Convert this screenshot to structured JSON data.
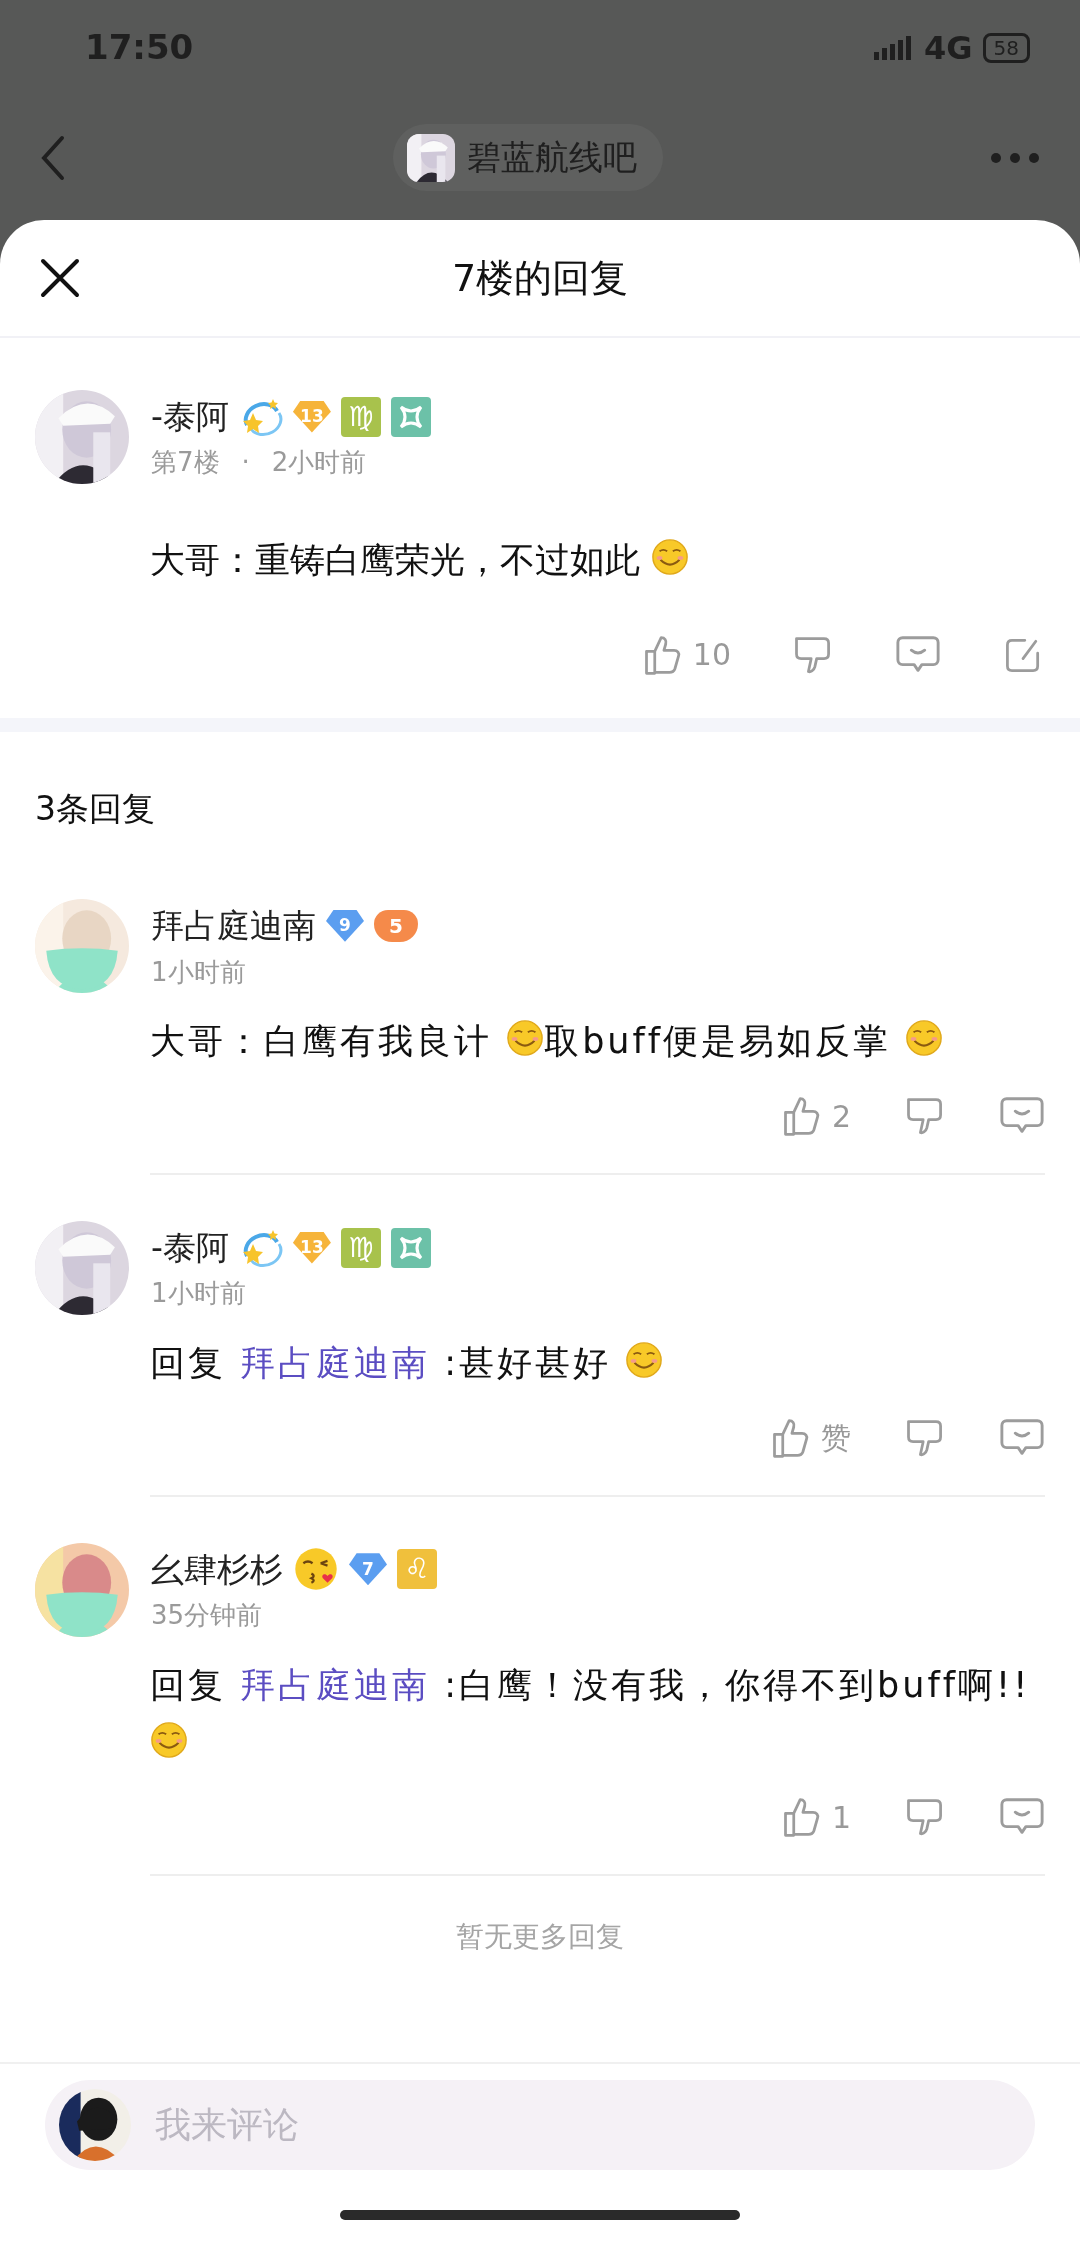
{
  "status_bar": {
    "time": "17:50",
    "network": "4G",
    "battery": "58"
  },
  "nav": {
    "forum": "碧蓝航线吧"
  },
  "sheet": {
    "title": "7楼的回复"
  },
  "post": {
    "author": "-泰阿",
    "badges": [
      {
        "kind": "star"
      },
      {
        "kind": "level",
        "text": "13",
        "color": "#f6b43a"
      },
      {
        "kind": "zodiac",
        "text": "♍",
        "color": "#a8c24c"
      },
      {
        "kind": "symbol",
        "color": "#6cc1a8"
      }
    ],
    "floor": "第7楼",
    "separator": "·",
    "time": "2小时前",
    "content": [
      {
        "kind": "text",
        "text": "大哥：重铸白鹰荣光，不过如此"
      },
      {
        "kind": "emoji"
      }
    ],
    "actions": [
      {
        "kind": "like",
        "count": "10"
      },
      {
        "kind": "dislike"
      },
      {
        "kind": "reply"
      },
      {
        "kind": "share"
      }
    ]
  },
  "reply_count": "3条回复",
  "replies": [
    {
      "author": "拜占庭迪南",
      "badges": [
        {
          "kind": "level",
          "text": "9",
          "color": "#5b9ef0"
        },
        {
          "kind": "game",
          "text": "5",
          "color": "#f58a4a"
        }
      ],
      "time": "1小时前",
      "content": [
        {
          "kind": "text",
          "text": "大哥：白鹰有我良计"
        },
        {
          "kind": "emoji"
        },
        {
          "kind": "text",
          "text": "取buff便是易如反掌"
        },
        {
          "kind": "emoji"
        }
      ],
      "actions": [
        {
          "kind": "like",
          "count": "2"
        },
        {
          "kind": "dislike"
        },
        {
          "kind": "reply"
        }
      ]
    },
    {
      "author": "-泰阿",
      "badges": [
        {
          "kind": "star"
        },
        {
          "kind": "level",
          "text": "13",
          "color": "#f6b43a"
        },
        {
          "kind": "zodiac",
          "text": "♍",
          "color": "#a8c24c"
        },
        {
          "kind": "symbol",
          "color": "#6cc1a8"
        }
      ],
      "time": "1小时前",
      "content": [
        {
          "kind": "text",
          "text": "回复"
        },
        {
          "kind": "mention",
          "text": "拜占庭迪南"
        },
        {
          "kind": "text",
          "text": ":甚好甚好"
        },
        {
          "kind": "emoji"
        }
      ],
      "actions": [
        {
          "kind": "like",
          "count": "赞"
        },
        {
          "kind": "dislike"
        },
        {
          "kind": "reply"
        }
      ]
    },
    {
      "author": "幺肆杉杉",
      "badges": [
        {
          "kind": "kiss"
        },
        {
          "kind": "level",
          "text": "7",
          "color": "#5b9ef0"
        },
        {
          "kind": "zodiac",
          "text": "♌",
          "color": "#f0c03c"
        }
      ],
      "time": "35分钟前",
      "content": [
        {
          "kind": "text",
          "text": "回复"
        },
        {
          "kind": "mention",
          "text": "拜占庭迪南"
        },
        {
          "kind": "text",
          "text": ":白鹰！没有我，你得不到buff啊!!"
        },
        {
          "kind": "emoji"
        }
      ],
      "actions": [
        {
          "kind": "like",
          "count": "1"
        },
        {
          "kind": "dislike"
        },
        {
          "kind": "reply"
        }
      ]
    }
  ],
  "footer": "暂无更多回复",
  "comment_box": {
    "placeholder": "我来评论"
  }
}
